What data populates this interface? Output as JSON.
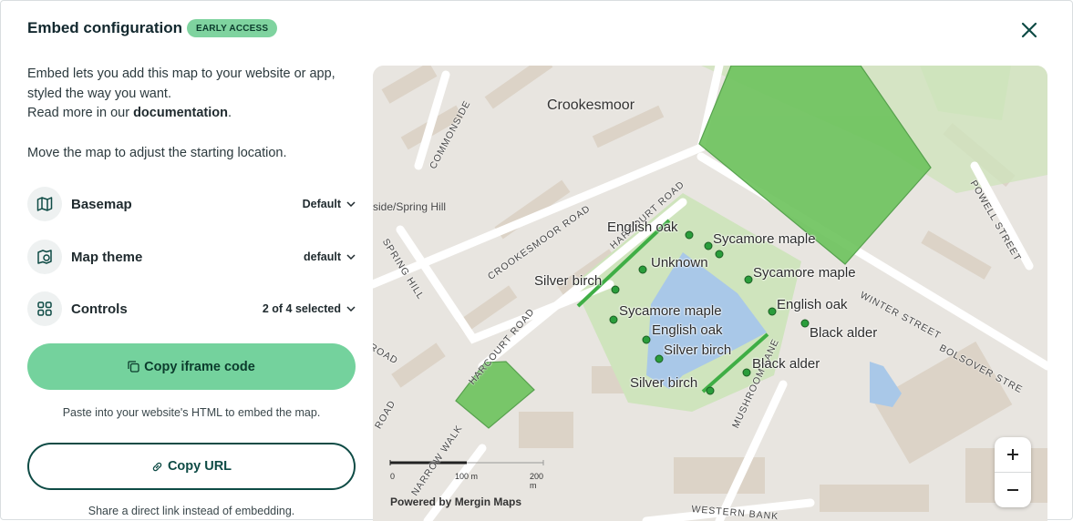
{
  "header": {
    "title": "Embed configuration",
    "badge": "EARLY ACCESS"
  },
  "intro": {
    "line1": "Embed lets you add this map to your website or app,",
    "line2": "styled the way you want.",
    "read_prefix": "Read more in our ",
    "read_link": "documentation",
    "read_suffix": "."
  },
  "move_text": "Move the map to adjust the starting location.",
  "settings": [
    {
      "label": "Basemap",
      "value": "Default",
      "icon": "map-icon"
    },
    {
      "label": "Map theme",
      "value": "default",
      "icon": "theme-icon"
    },
    {
      "label": "Controls",
      "value": "2 of 4 selected",
      "icon": "grid-icon"
    }
  ],
  "copy_iframe": {
    "label": "Copy iframe code",
    "hint": "Paste into your website's HTML to embed the map."
  },
  "copy_url": {
    "label": "Copy URL",
    "hint": "Share a direct link instead of embedding."
  },
  "map": {
    "place_label": "Crookesmoor",
    "roads": [
      "COMMONSIDE",
      "CROOKESMOOR ROAD",
      "HARCOURT ROAD",
      "SPRING HILL",
      "POWELL STREET",
      "WINTER STREET",
      "BOLSOVER STRE",
      "MUSHROOM LANE",
      "NARROW WALK",
      "WESTERN BANK",
      "HARCOURT ROAD",
      "ROAD",
      "ROAD"
    ],
    "area_label": "side/Spring Hill",
    "trees": [
      {
        "name": "English oak"
      },
      {
        "name": "Sycamore maple"
      },
      {
        "name": "Unknown"
      },
      {
        "name": "Sycamore maple"
      },
      {
        "name": "Silver birch"
      },
      {
        "name": "English oak"
      },
      {
        "name": "Sycamore maple"
      },
      {
        "name": "English oak"
      },
      {
        "name": "Black alder"
      },
      {
        "name": "Silver birch"
      },
      {
        "name": "Black alder"
      },
      {
        "name": "Silver birch"
      }
    ],
    "scale": {
      "ticks": [
        "0",
        "100 m",
        "200 m"
      ]
    },
    "attribution": "Powered by Mergin Maps",
    "zoom_in": "+",
    "zoom_out": "−",
    "colors": {
      "feature_fill": "#6fc45f",
      "water": "#a9c8e8",
      "park": "#cde6b7",
      "point": "#2a9d3b"
    }
  }
}
